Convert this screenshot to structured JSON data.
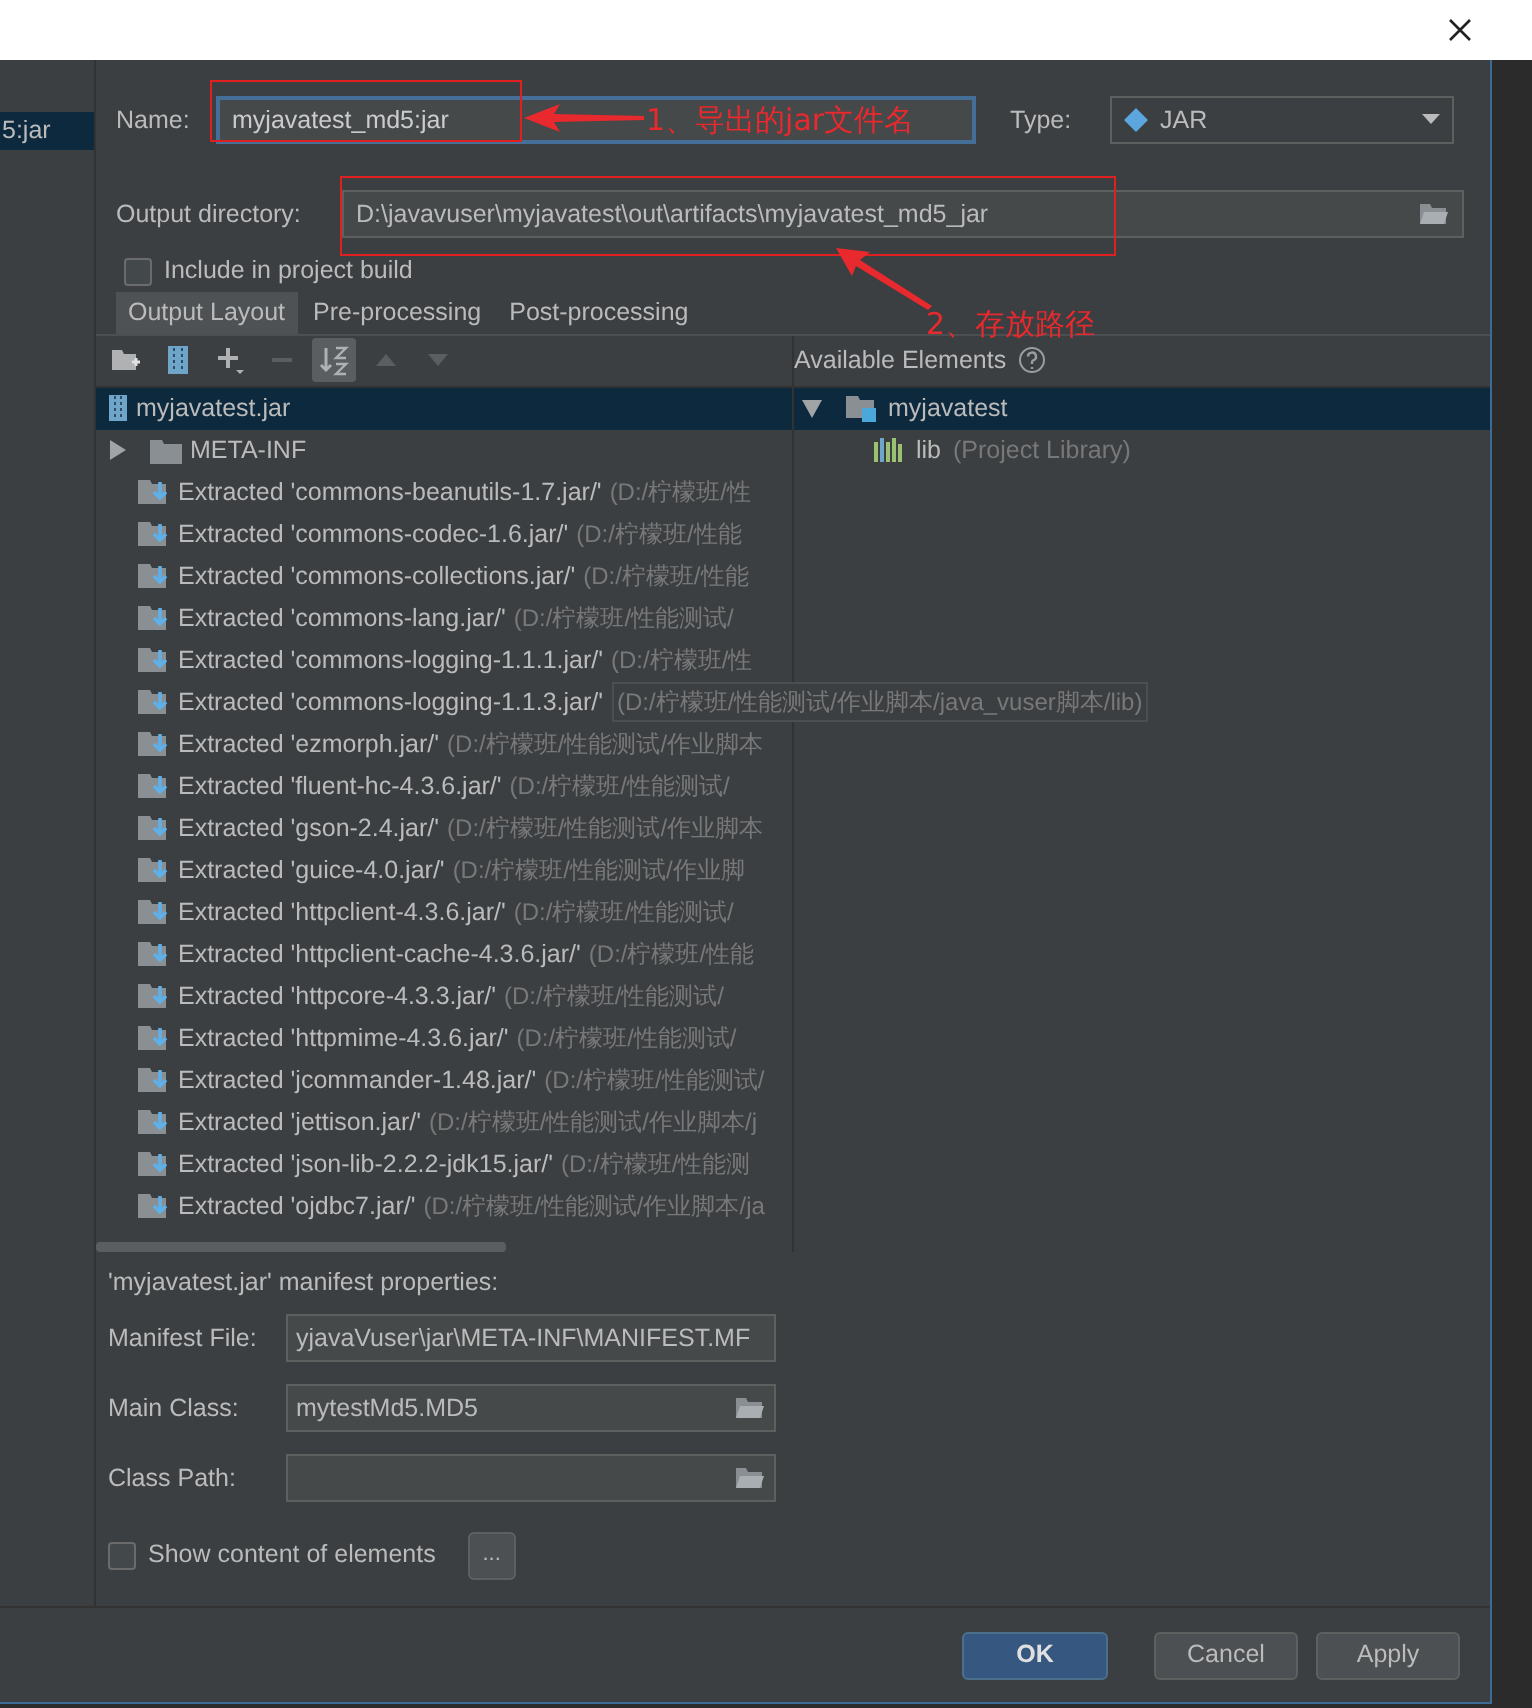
{
  "sidebar": {
    "items": [
      {
        "label": "5:jar",
        "selected": true
      }
    ]
  },
  "name_field": {
    "label": "Name:",
    "value": "myjavatest_md5:jar"
  },
  "type_select": {
    "label": "Type:",
    "value": "JAR"
  },
  "output_directory": {
    "label": "Output directory:",
    "value": "D:\\javavuser\\myjavatest\\out\\artifacts\\myjavatest_md5_jar"
  },
  "include_in_build": {
    "label": "Include in project build",
    "checked": false
  },
  "tabs": [
    {
      "label": "Output Layout",
      "selected": true
    },
    {
      "label": "Pre-processing",
      "selected": false
    },
    {
      "label": "Post-processing",
      "selected": false
    }
  ],
  "toolbar": [
    {
      "kind": "add-folder",
      "disabled": false,
      "on": false
    },
    {
      "kind": "archive",
      "disabled": false,
      "on": false
    },
    {
      "kind": "add",
      "disabled": false,
      "on": false
    },
    {
      "kind": "remove",
      "disabled": true,
      "on": false
    },
    {
      "kind": "sort",
      "disabled": false,
      "on": true
    },
    {
      "kind": "up",
      "disabled": true,
      "on": false
    },
    {
      "kind": "down",
      "disabled": true,
      "on": false
    }
  ],
  "layout_tree": [
    {
      "kind": "archive",
      "label": "myjavatest.jar",
      "selected": true
    },
    {
      "kind": "folder",
      "label": "META-INF",
      "expanded": false,
      "selected": false
    },
    {
      "kind": "extracted",
      "label": "Extracted 'commons-beanutils-1.7.jar/'",
      "path": "(D:/柠檬班/性",
      "hovered": false,
      "selected": false
    },
    {
      "kind": "extracted",
      "label": "Extracted 'commons-codec-1.6.jar/'",
      "path": "(D:/柠檬班/性能",
      "hovered": false,
      "selected": false
    },
    {
      "kind": "extracted",
      "label": "Extracted 'commons-collections.jar/'",
      "path": "(D:/柠檬班/性能",
      "hovered": false,
      "selected": false
    },
    {
      "kind": "extracted",
      "label": "Extracted 'commons-lang.jar/'",
      "path": "(D:/柠檬班/性能测试/",
      "hovered": false,
      "selected": false
    },
    {
      "kind": "extracted",
      "label": "Extracted 'commons-logging-1.1.1.jar/'",
      "path": "(D:/柠檬班/性",
      "hovered": false,
      "selected": false
    },
    {
      "kind": "extracted",
      "label": "Extracted 'commons-logging-1.1.3.jar/'",
      "path": "(D:/柠檬班/性能测试/作业脚本/java_vuser脚本/lib)",
      "hovered": true,
      "selected": false
    },
    {
      "kind": "extracted",
      "label": "Extracted 'ezmorph.jar/'",
      "path": "(D:/柠檬班/性能测试/作业脚本",
      "hovered": false,
      "selected": false
    },
    {
      "kind": "extracted",
      "label": "Extracted 'fluent-hc-4.3.6.jar/'",
      "path": "(D:/柠檬班/性能测试/",
      "hovered": false,
      "selected": false
    },
    {
      "kind": "extracted",
      "label": "Extracted 'gson-2.4.jar/'",
      "path": "(D:/柠檬班/性能测试/作业脚本",
      "hovered": false,
      "selected": false
    },
    {
      "kind": "extracted",
      "label": "Extracted 'guice-4.0.jar/'",
      "path": "(D:/柠檬班/性能测试/作业脚",
      "hovered": false,
      "selected": false
    },
    {
      "kind": "extracted",
      "label": "Extracted 'httpclient-4.3.6.jar/'",
      "path": "(D:/柠檬班/性能测试/",
      "hovered": false,
      "selected": false
    },
    {
      "kind": "extracted",
      "label": "Extracted 'httpclient-cache-4.3.6.jar/'",
      "path": "(D:/柠檬班/性能",
      "hovered": false,
      "selected": false
    },
    {
      "kind": "extracted",
      "label": "Extracted 'httpcore-4.3.3.jar/'",
      "path": "(D:/柠檬班/性能测试/",
      "hovered": false,
      "selected": false
    },
    {
      "kind": "extracted",
      "label": "Extracted 'httpmime-4.3.6.jar/'",
      "path": "(D:/柠檬班/性能测试/",
      "hovered": false,
      "selected": false
    },
    {
      "kind": "extracted",
      "label": "Extracted 'jcommander-1.48.jar/'",
      "path": "(D:/柠檬班/性能测试/",
      "hovered": false,
      "selected": false
    },
    {
      "kind": "extracted",
      "label": "Extracted 'jettison.jar/'",
      "path": "(D:/柠檬班/性能测试/作业脚本/j",
      "hovered": false,
      "selected": false
    },
    {
      "kind": "extracted",
      "label": "Extracted 'json-lib-2.2.2-jdk15.jar/'",
      "path": "(D:/柠檬班/性能测",
      "hovered": false,
      "selected": false
    },
    {
      "kind": "extracted",
      "label": "Extracted 'ojdbc7.jar/'",
      "path": "(D:/柠檬班/性能测试/作业脚本/ja",
      "hovered": false,
      "selected": false
    }
  ],
  "available_elements": {
    "title": "Available Elements",
    "tree": [
      {
        "label": "myjavatest",
        "selected": true,
        "expanded": true,
        "children": [
          {
            "label": "lib",
            "note": "(Project Library)",
            "selected": false
          }
        ]
      }
    ]
  },
  "manifest": {
    "title": "'myjavatest.jar' manifest properties:",
    "fields": [
      {
        "label": "Manifest File:",
        "value": "yjavaVuser\\jar\\META-INF\\MANIFEST.MF",
        "browse": false
      },
      {
        "label": "Main Class:",
        "value": "mytestMd5.MD5",
        "browse": true
      },
      {
        "label": "Class Path:",
        "browse": true
      }
    ]
  },
  "show_content": {
    "label": "Show content of elements",
    "checked": false,
    "button": "..."
  },
  "buttons": [
    {
      "label": "OK",
      "kind": "primary"
    },
    {
      "label": "Cancel",
      "kind": "default"
    },
    {
      "label": "Apply",
      "kind": "default"
    }
  ],
  "annotations": [
    {
      "label": "1、导出的jar文件名"
    },
    {
      "label": "2、存放路径"
    }
  ]
}
